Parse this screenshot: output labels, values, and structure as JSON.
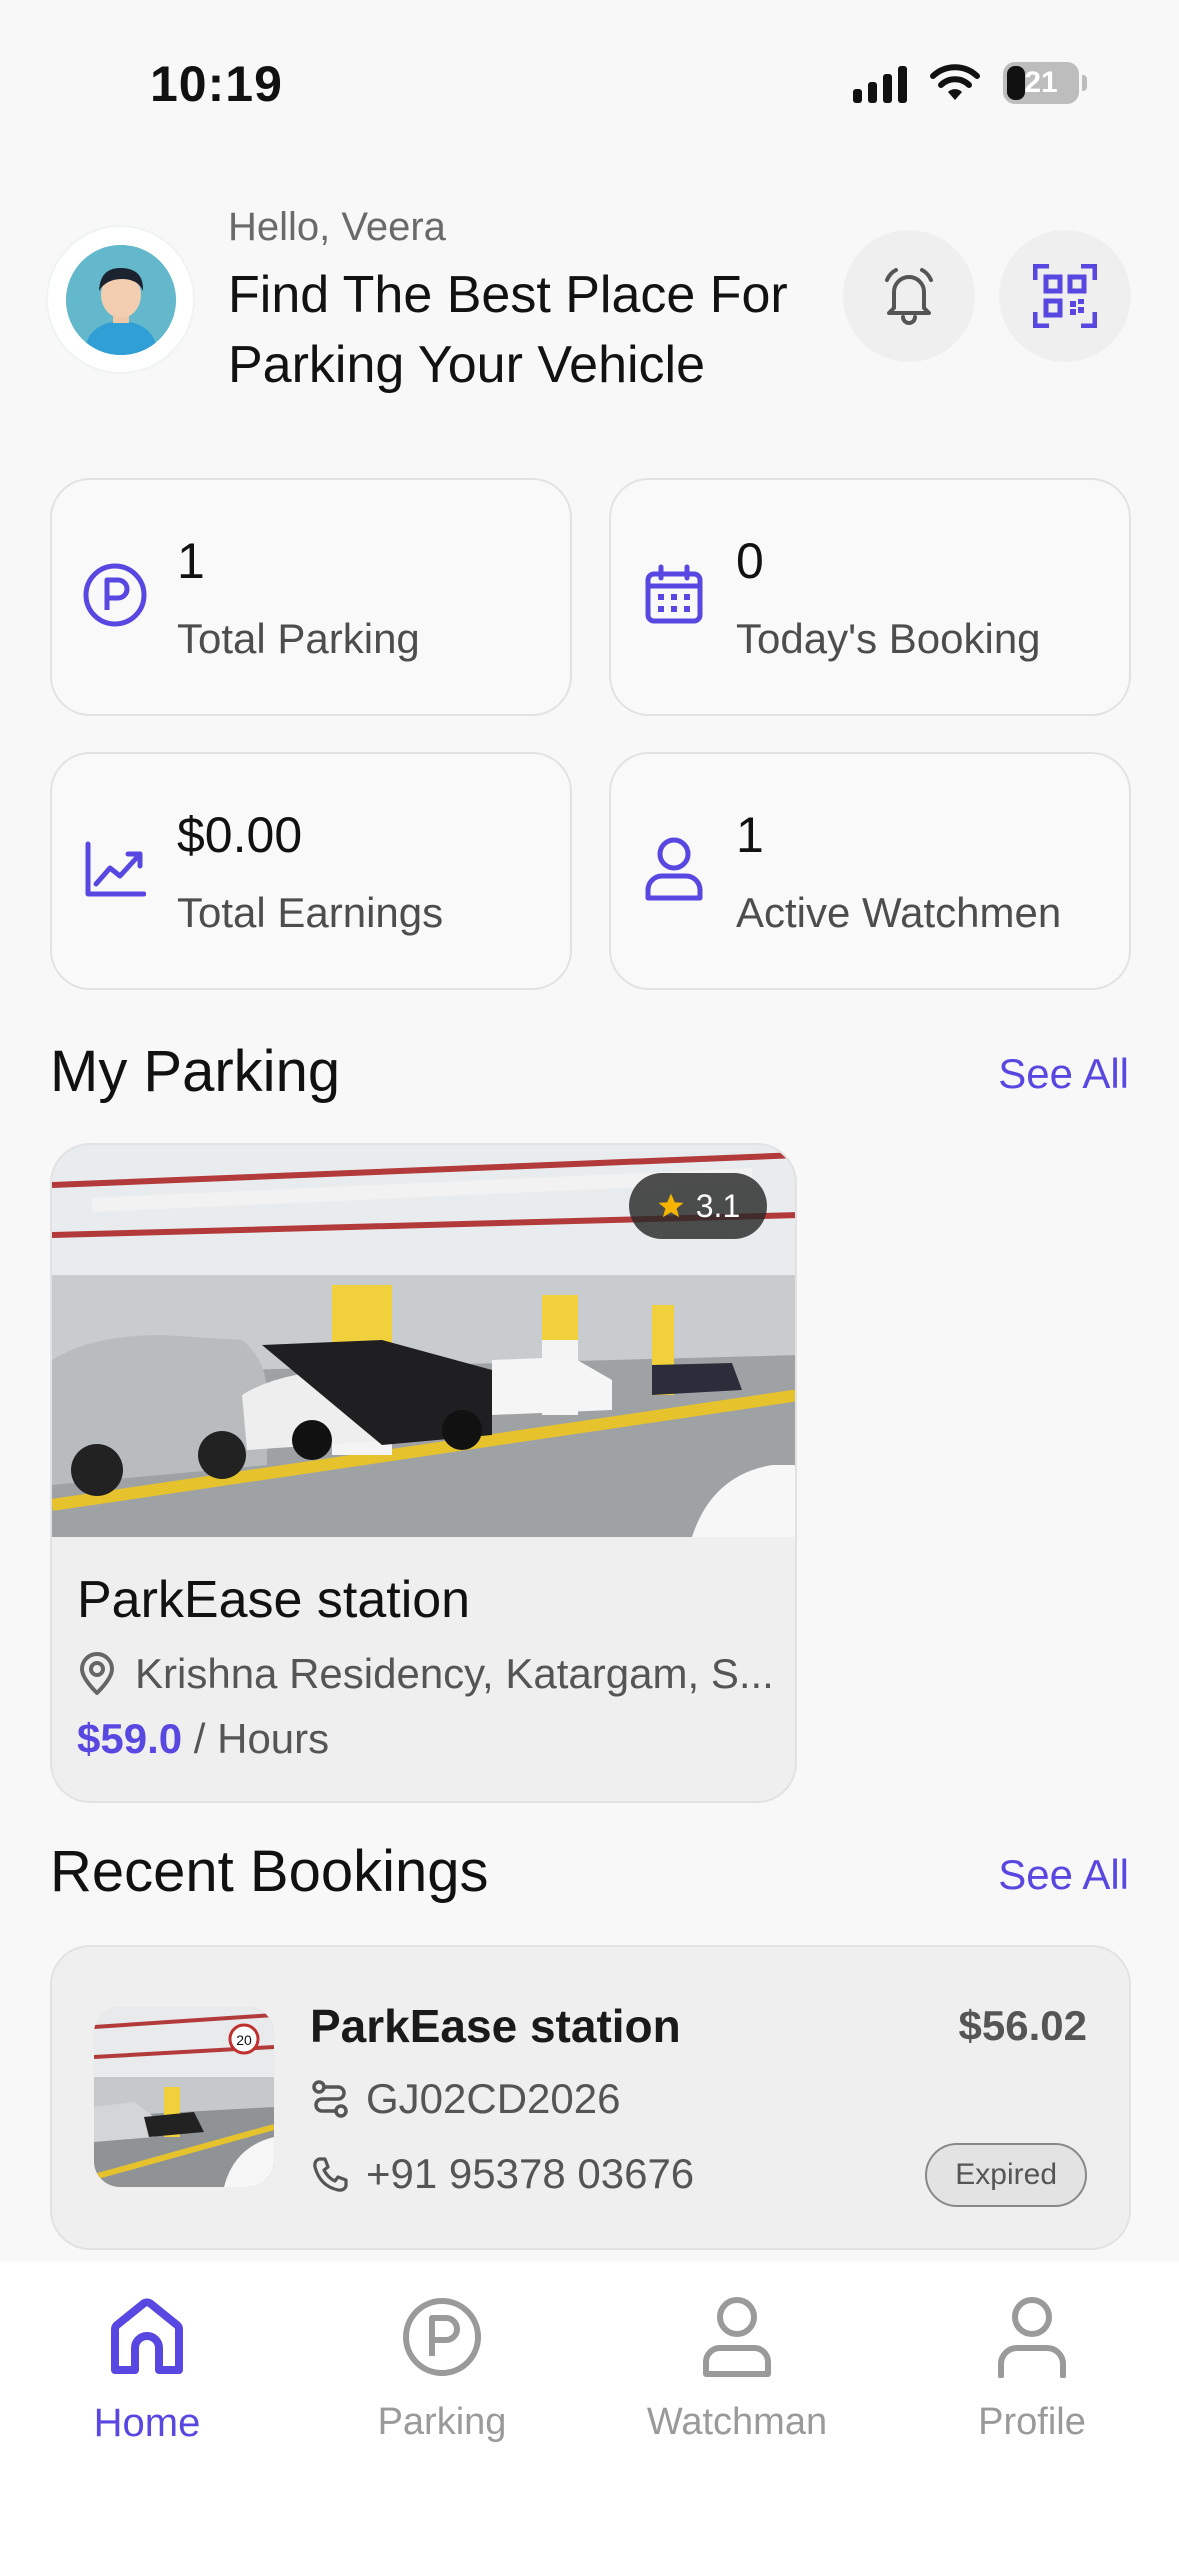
{
  "status_bar": {
    "time": "10:19",
    "battery": "21"
  },
  "header": {
    "greeting": "Hello, Veera",
    "headline": "Find The Best Place For Parking Your Vehicle",
    "avatar_icon": "user-avatar",
    "bell_icon": "bell-icon",
    "qr_icon": "qr-code-icon"
  },
  "stats": [
    {
      "value": "1",
      "label": "Total Parking",
      "icon": "parking-icon"
    },
    {
      "value": "0",
      "label": "Today's Booking",
      "icon": "calendar-icon"
    },
    {
      "value": "$0.00",
      "label": "Total Earnings",
      "icon": "trend-chart-icon"
    },
    {
      "value": "1",
      "label": "Active Watchmen",
      "icon": "user-icon"
    }
  ],
  "my_parking": {
    "title": "My Parking",
    "see_all": "See All",
    "card": {
      "name": "ParkEase station",
      "rating": "3.1",
      "location": "Krishna Residency, Katargam, S...",
      "price": "$59.0",
      "price_unit": " / Hours"
    }
  },
  "recent_bookings": {
    "title": "Recent Bookings",
    "see_all": "See All",
    "items": [
      {
        "name": "ParkEase station",
        "vehicle": "GJ02CD2026",
        "phone": "+91 95378 03676",
        "price": "$56.02",
        "status": "Expired"
      }
    ]
  },
  "bottom_nav": [
    {
      "label": "Home",
      "icon": "home-icon",
      "active": true
    },
    {
      "label": "Parking",
      "icon": "parking-icon",
      "active": false
    },
    {
      "label": "Watchman",
      "icon": "watchman-icon",
      "active": false
    },
    {
      "label": "Profile",
      "icon": "profile-icon",
      "active": false
    }
  ],
  "colors": {
    "accent": "#5847e0",
    "background": "#f8f8f9",
    "star": "#f5b400"
  }
}
